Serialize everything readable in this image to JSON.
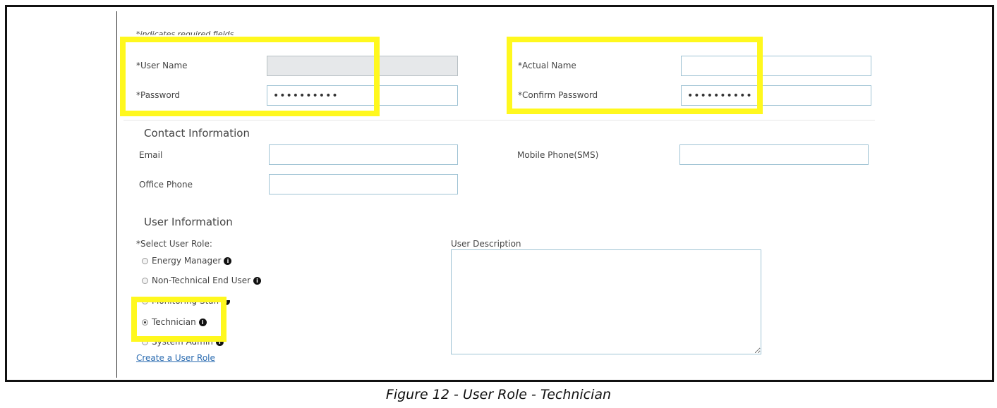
{
  "form": {
    "required_note": "*indicates required fields",
    "credentials": {
      "user_name_label": "*User Name",
      "user_name_value": "",
      "password_label": "*Password",
      "password_value": "••••••••••",
      "actual_name_label": "*Actual Name",
      "actual_name_value": "",
      "confirm_password_label": "*Confirm Password",
      "confirm_password_value": "••••••••••"
    },
    "contact": {
      "title": "Contact Information",
      "email_label": "Email",
      "mobile_label": "Mobile Phone(SMS)",
      "office_label": "Office Phone"
    },
    "user_info": {
      "title": "User Information",
      "role_label": "*Select User Role:",
      "roles": [
        {
          "label": "Energy Manager",
          "checked": false
        },
        {
          "label": "Non-Technical End User",
          "checked": false
        },
        {
          "label": "Monitoring Staff",
          "checked": false
        },
        {
          "label": "Technician",
          "checked": true
        },
        {
          "label": "System Admin",
          "checked": false
        }
      ],
      "info_glyph": "i",
      "description_label": "User Description",
      "create_role_link": "Create a User Role"
    }
  },
  "caption": "Figure 12 - User Role - Technician",
  "colors": {
    "highlight": "#fff81e",
    "field_border": "#9fc3d4",
    "link": "#2a6bb0"
  }
}
